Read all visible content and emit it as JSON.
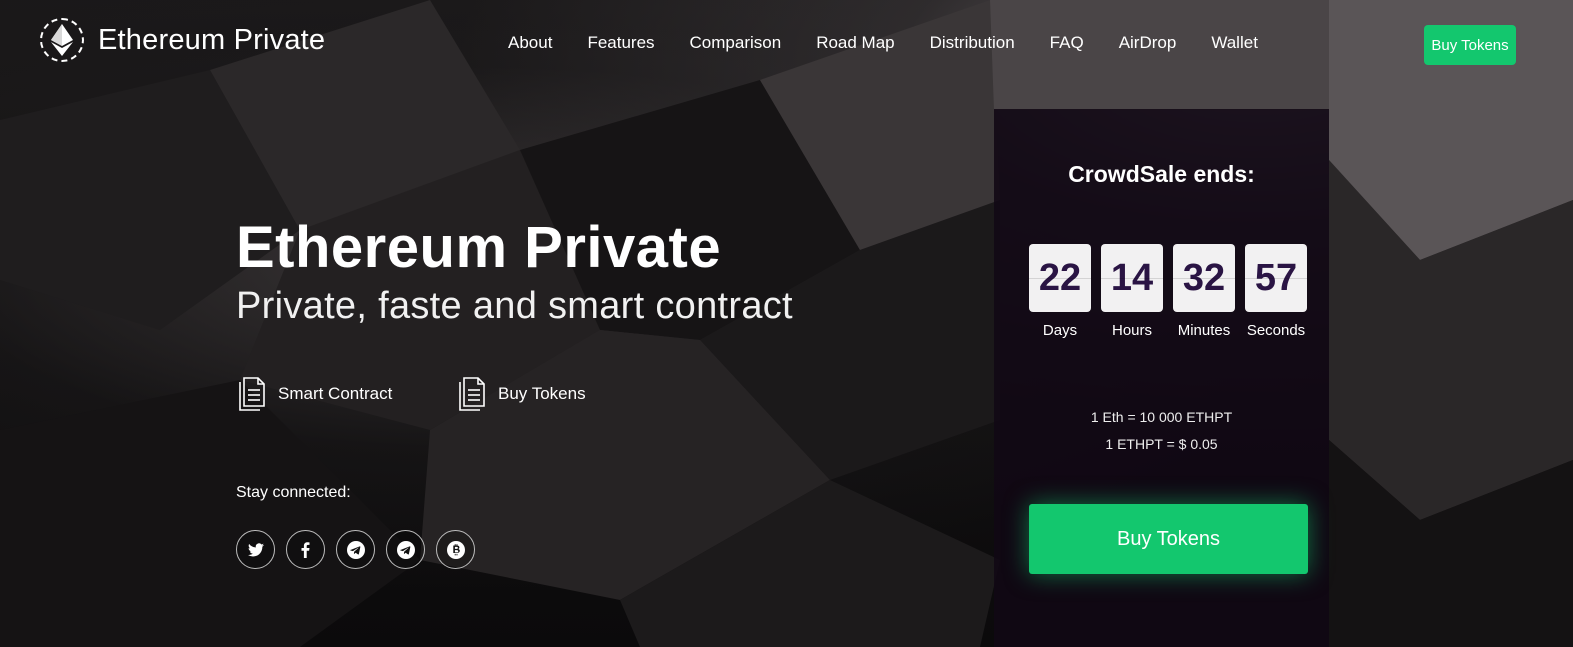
{
  "brand": {
    "name": "Ethereum Private",
    "logo_icon": "ethereum-icon"
  },
  "nav": {
    "items": [
      "About",
      "Features",
      "Comparison",
      "Road Map",
      "Distribution",
      "FAQ",
      "AirDrop",
      "Wallet"
    ],
    "cta": "Buy Tokens"
  },
  "hero": {
    "title": "Ethereum Private",
    "subtitle": "Private, faste and smart contract",
    "links": [
      {
        "label": "Smart Contract",
        "icon": "document-icon"
      },
      {
        "label": "Buy Tokens",
        "icon": "document-icon"
      }
    ],
    "stay_connected": "Stay connected:",
    "socials": [
      "twitter-icon",
      "facebook-icon",
      "telegram-icon",
      "telegram-icon",
      "bitcoin-icon"
    ]
  },
  "crowdsale": {
    "title": "CrowdSale ends:",
    "countdown": [
      {
        "value": "22",
        "unit": "Days"
      },
      {
        "value": "14",
        "unit": "Hours"
      },
      {
        "value": "32",
        "unit": "Minutes"
      },
      {
        "value": "57",
        "unit": "Seconds"
      }
    ],
    "rates": [
      "1 Eth = 10 000 ETHPT",
      "1 ETHPT = $ 0.05"
    ],
    "button": "Buy Tokens"
  },
  "colors": {
    "accent": "#13c76e",
    "digit_text": "#2a1444",
    "panel_bg": "#110814"
  }
}
